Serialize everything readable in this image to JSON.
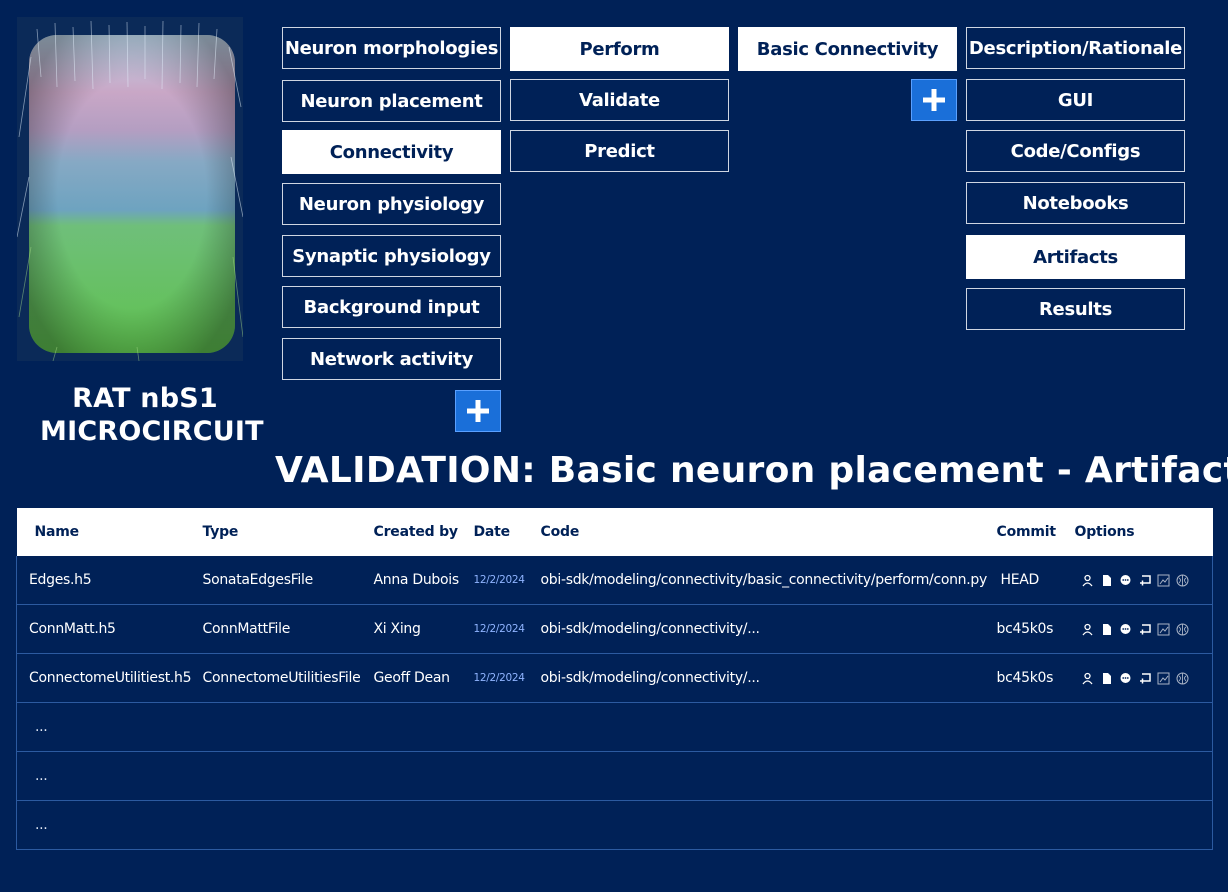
{
  "circuit": {
    "name_line1": "RAT nbS1",
    "name_line2": "MICROCIRCUIT"
  },
  "col1": [
    {
      "label": "Neuron morphologies",
      "active": false
    },
    {
      "label": "Neuron placement",
      "active": false
    },
    {
      "label": "Connectivity",
      "active": true
    },
    {
      "label": "Neuron physiology",
      "active": false
    },
    {
      "label": "Synaptic physiology",
      "active": false
    },
    {
      "label": "Background input",
      "active": false
    },
    {
      "label": "Network activity",
      "active": false
    }
  ],
  "col2": [
    {
      "label": "Perform",
      "active": true
    },
    {
      "label": "Validate",
      "active": false
    },
    {
      "label": "Predict",
      "active": false
    }
  ],
  "col3": [
    {
      "label": "Basic Connectivity",
      "active": true
    }
  ],
  "col4": [
    {
      "label": "Description/Rationale",
      "active": false
    },
    {
      "label": "GUI",
      "active": false
    },
    {
      "label": "Code/Configs",
      "active": false
    },
    {
      "label": "Notebooks",
      "active": false
    },
    {
      "label": "Artifacts",
      "active": true
    },
    {
      "label": "Results",
      "active": false
    }
  ],
  "page_title": "VALIDATION: Basic neuron placement - Artifacts",
  "table": {
    "headers": {
      "name": "Name",
      "type": "Type",
      "created_by": "Created by",
      "date": "Date",
      "code": "Code",
      "commit": "Commit",
      "options": "Options"
    },
    "rows": [
      {
        "name": "Edges.h5",
        "type": "SonataEdgesFile",
        "created_by": "Anna Dubois",
        "date": "12/2/2024",
        "code": "obi-sdk/modeling/connectivity/basic_connectivity/perform/conn.py",
        "commit": "HEAD"
      },
      {
        "name": "ConnMatt.h5",
        "type": "ConnMattFile",
        "created_by": "Xi Xing",
        "date": "12/2/2024",
        "code": "obi-sdk/modeling/connectivity/...",
        "commit": "bc45k0s"
      },
      {
        "name": "ConnectomeUtilitiest.h5",
        "type": "ConnectomeUtilitiesFile",
        "created_by": "Geoff Dean",
        "date": "12/2/2024",
        "code": "obi-sdk/modeling/connectivity/...",
        "commit": "bc45k0s"
      }
    ],
    "ellipsis_rows": [
      "...",
      "...",
      "..."
    ],
    "option_icons": [
      "person-icon",
      "file-icon",
      "comment-icon",
      "add-frame-icon",
      "chart-icon",
      "brain-icon"
    ]
  },
  "colors": {
    "background": "#002157",
    "active_button": "#ffffff",
    "plus_button": "#1a6fd9"
  }
}
